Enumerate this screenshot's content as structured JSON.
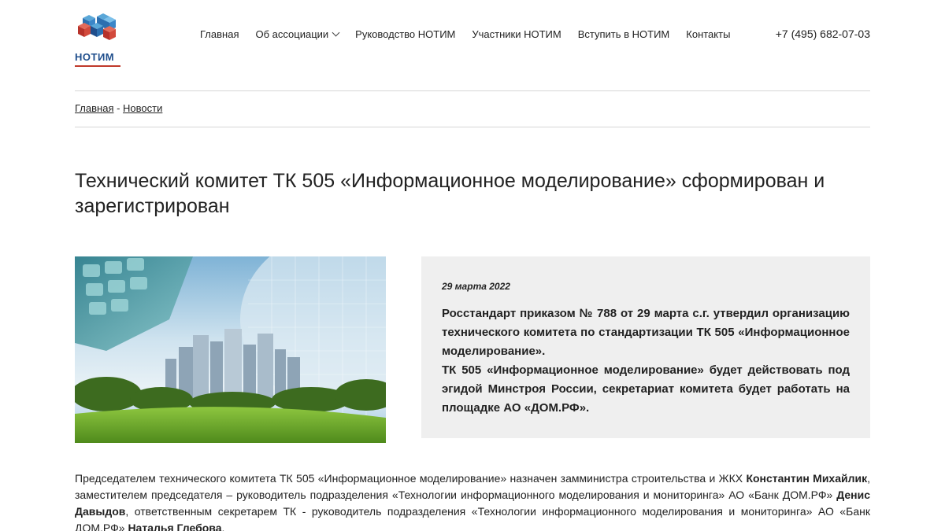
{
  "brand": {
    "name": "НОТИМ"
  },
  "nav": {
    "items": [
      {
        "label": "Главная"
      },
      {
        "label": "Об ассоциации"
      },
      {
        "label": "Руководство НОТИМ"
      },
      {
        "label": "Участники НОТИМ"
      },
      {
        "label": "Вступить в НОТИМ"
      },
      {
        "label": "Контакты"
      }
    ],
    "phone": "+7 (495) 682-07-03"
  },
  "breadcrumb": {
    "home": "Главная",
    "separator": " - ",
    "current": "Новости"
  },
  "article": {
    "title": "Технический комитет ТК 505 «Информационное моделирование» сформирован и зарегистрирован",
    "date": "29 марта 2022",
    "lead_p1": "Росстандарт приказом № 788 от 29 марта с.г. утвердил организацию технического комитета по стандартизации ТК 505 «Информационное моделирование».",
    "lead_p2": "ТК 505 «Информационное моделирование» будет действовать под эгидой Минстроя России, секретариат комитета будет работать на площадке АО «ДОМ.РФ».",
    "body": {
      "t1": "Председателем технического комитета ТК 505 «Информационное моделирование» назначен замминистра строительства и ЖКХ ",
      "b1": "Константин Михайлик",
      "t2": ", заместителем председателя – руководитель подразделения «Технологии информационного моделирования и мониторинга» АО «Банк ДОМ.РФ» ",
      "b2": "Денис Давыдов",
      "t3": ", ответственным секретарем ТК - руководитель подразделения «Технологии информационного моделирования и мониторинга» АО «Банк ДОМ.РФ» ",
      "b3": "Наталья Глебова",
      "t4": "."
    }
  },
  "colors": {
    "accent_blue": "#1f4e8c",
    "accent_red": "#c0392b",
    "box_bg": "#efefef"
  }
}
